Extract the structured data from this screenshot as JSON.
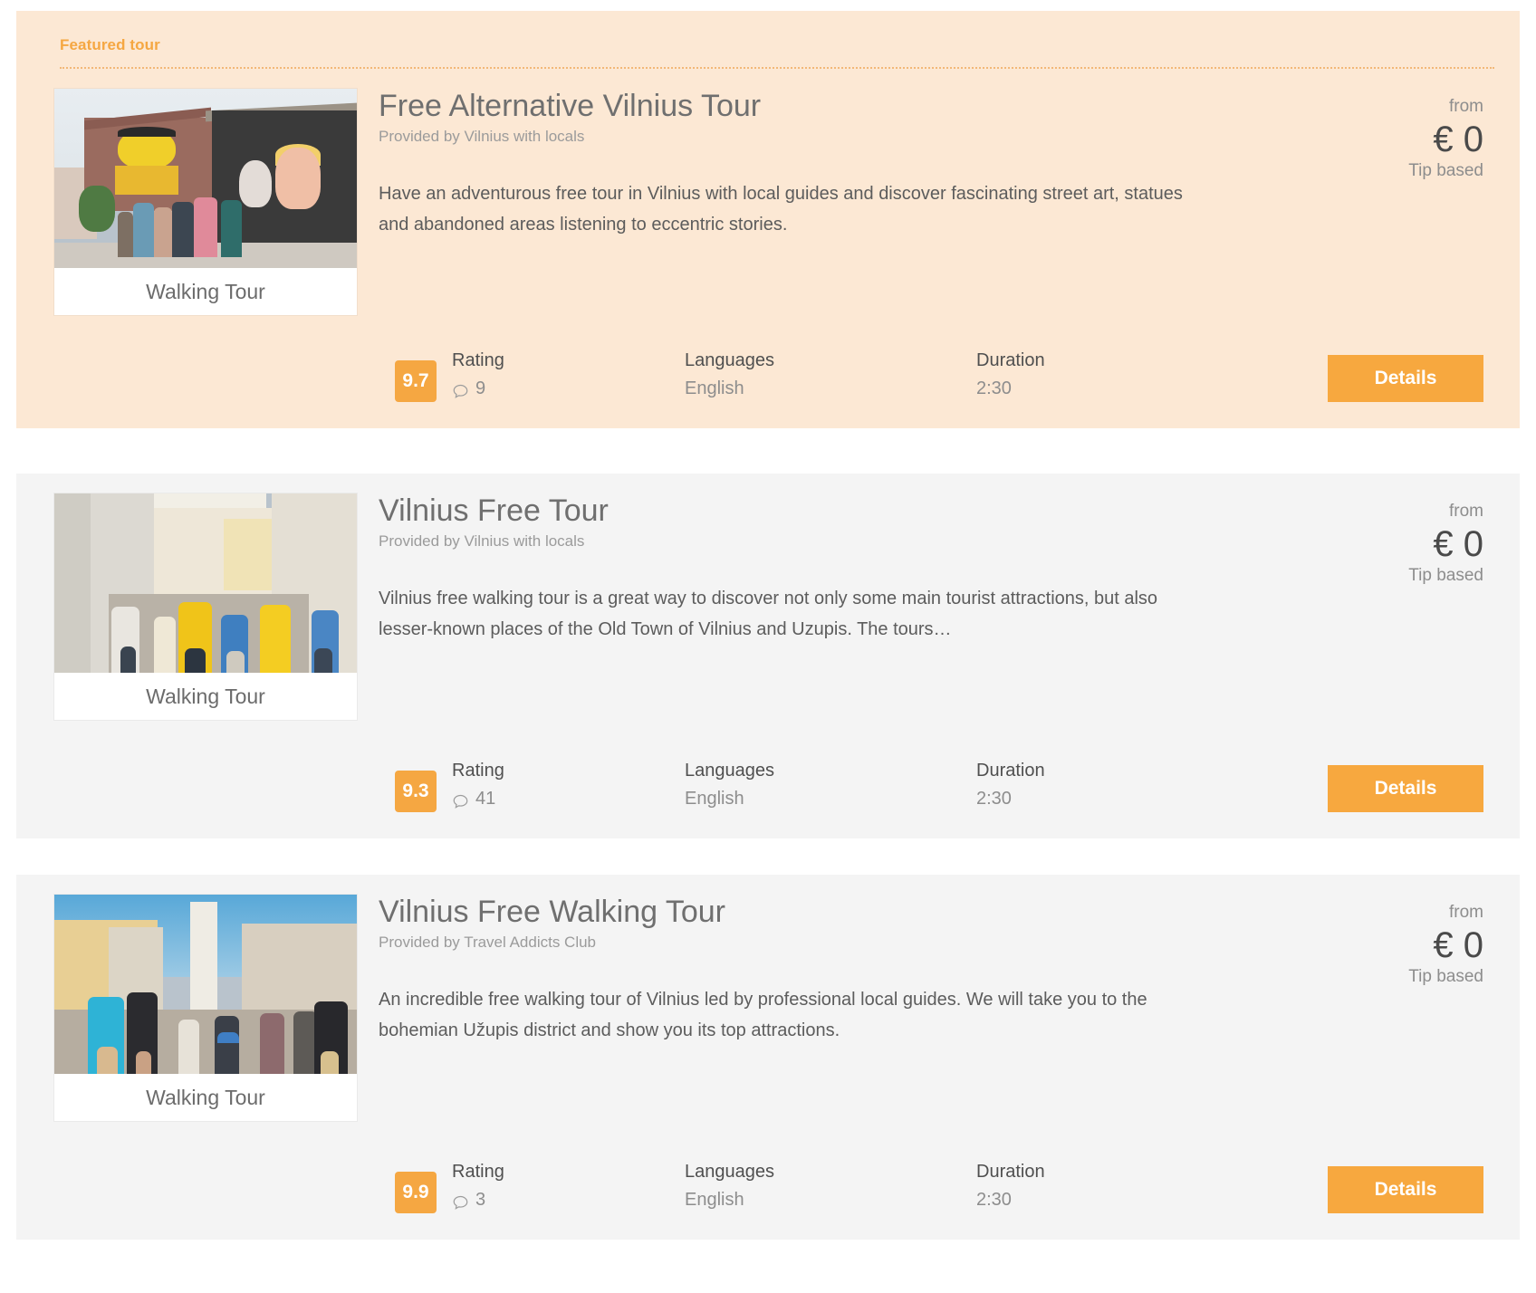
{
  "featured_label": "Featured tour",
  "labels": {
    "rating": "Rating",
    "languages": "Languages",
    "duration": "Duration",
    "from": "from",
    "details": "Details",
    "category": "Walking Tour"
  },
  "colors": {
    "accent": "#f5a742",
    "featured_bg": "#fce8d4",
    "card_bg": "#f4f4f4",
    "title": "#6f6f6f",
    "muted": "#9b9b9b"
  },
  "tours": [
    {
      "title": "Free Alternative Vilnius Tour",
      "provider": "Provided by Vilnius with locals",
      "description": "Have an adventurous free tour in Vilnius with local guides and discover fascinating street art, statues and abandoned areas listening to eccentric stories.",
      "category": "Walking Tour",
      "price_from": "from",
      "price": "€ 0",
      "price_note": "Tip based",
      "score": "9.7",
      "reviews": "9",
      "languages": "English",
      "duration": "2:30",
      "details": "Details",
      "featured": true
    },
    {
      "title": "Vilnius Free Tour",
      "provider": "Provided by Vilnius with locals",
      "description": "Vilnius free walking tour is a great way to discover not only some main tourist attractions, but also lesser-known places of the Old Town of Vilnius and Uzupis. The tours…",
      "category": "Walking Tour",
      "price_from": "from",
      "price": "€ 0",
      "price_note": "Tip based",
      "score": "9.3",
      "reviews": "41",
      "languages": "English",
      "duration": "2:30",
      "details": "Details",
      "featured": false
    },
    {
      "title": "Vilnius Free Walking Tour",
      "provider": "Provided by Travel Addicts Club",
      "description": "An incredible free walking tour of Vilnius led by professional local guides. We will take you to the bohemian Užupis district and show you its top attractions.",
      "category": "Walking Tour",
      "price_from": "from",
      "price": "€ 0",
      "price_note": "Tip based",
      "score": "9.9",
      "reviews": "3",
      "languages": "English",
      "duration": "2:30",
      "details": "Details",
      "featured": false
    }
  ]
}
